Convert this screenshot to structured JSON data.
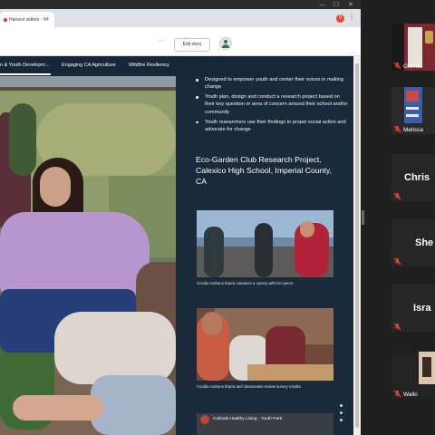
{
  "browser": {
    "tab_title": "Harvest videos - Yo",
    "tab_close": "×",
    "extension_badge": "0",
    "menu_icon": "⋮",
    "window_minimize": "—",
    "window_maximize": "☐",
    "window_close": "✕"
  },
  "site": {
    "more_icon": "···",
    "edit_button": "Edit story",
    "nav": [
      "n & Youth Developm…",
      "Engaging CA Agriculture",
      "Wildfire Resiliency"
    ]
  },
  "panel": {
    "bullets": [
      "Designed to empower youth and center their voices in making change",
      "Youth plan, design and conduct a research project based on their key question or area of concern around their school and/or community",
      "Youth researchers use their findings to propel social action and advocate for change"
    ],
    "heading": "Eco-Garden Club Research Project, Calexico High School, Imperial County, CA",
    "captions": [
      "Cecilia Andrans Ibarra conducts a survey with her peers.",
      "Cecilia Andrans Ibarra and classmates review survey results."
    ],
    "video_title": "Cultivati Healthy Living - Youth Parti"
  },
  "participants": [
    {
      "name": "Glenda",
      "style": "video"
    },
    {
      "name": "Melissa",
      "style": "video"
    },
    {
      "name": "Chris",
      "style": "name"
    },
    {
      "name": "She",
      "style": "name"
    },
    {
      "name": "Isra",
      "style": "name"
    },
    {
      "name": "Walki",
      "style": "video"
    }
  ],
  "colors": {
    "nav_bg": "#16273a",
    "panel_bg": "#1b2a3a",
    "muted_mic": "#e8453c"
  }
}
